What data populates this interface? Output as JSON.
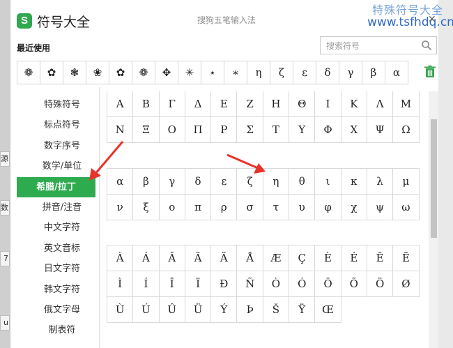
{
  "window": {
    "title": "符号大全",
    "ime_name": "搜狗五笔输入法",
    "logo_letter": "S"
  },
  "watermark": {
    "line1": "特殊符号大全",
    "line2": "www.tsfhdq.cn"
  },
  "recent": {
    "label": "最近使用",
    "symbols": [
      "❁",
      "✿",
      "❃",
      "❀",
      "✿",
      "❁",
      "✥",
      "✳",
      "⋆",
      "∗",
      "η",
      "ζ",
      "ε",
      "δ",
      "γ",
      "β",
      "α"
    ]
  },
  "search": {
    "placeholder": "搜索符号"
  },
  "sidebar": {
    "items": [
      "特殊符号",
      "标点符号",
      "数字序号",
      "数学/单位",
      "希腊/拉丁",
      "拼音/注音",
      "中文字符",
      "英文音标",
      "日文字符",
      "韩文字符",
      "俄文字母",
      "制表符"
    ],
    "active_index": 4
  },
  "grids": {
    "greek_upper": [
      "Α",
      "Β",
      "Γ",
      "Δ",
      "Ε",
      "Ζ",
      "Η",
      "Θ",
      "Ι",
      "Κ",
      "Λ",
      "Μ",
      "Ν",
      "Ξ",
      "Ο",
      "Π",
      "Ρ",
      "Σ",
      "Τ",
      "Υ",
      "Φ",
      "Χ",
      "Ψ",
      "Ω"
    ],
    "greek_lower": [
      "α",
      "β",
      "γ",
      "δ",
      "ε",
      "ζ",
      "η",
      "θ",
      "ι",
      "κ",
      "λ",
      "μ",
      "ν",
      "ξ",
      "ο",
      "π",
      "ρ",
      "σ",
      "τ",
      "υ",
      "φ",
      "χ",
      "ψ",
      "ω"
    ],
    "latin": [
      "À",
      "Á",
      "Â",
      "Ã",
      "Ä",
      "Å",
      "Æ",
      "Ç",
      "È",
      "É",
      "Ê",
      "Ë",
      "Ì",
      "Í",
      "Î",
      "Ï",
      "Ð",
      "Ñ",
      "Ò",
      "Ó",
      "Ô",
      "Õ",
      "Ö",
      "Ø",
      "Ù",
      "Ú",
      "Û",
      "Ü",
      "Ý",
      "Þ",
      "Š",
      "Ÿ",
      "Œ"
    ]
  },
  "background_tabs": [
    "源",
    "数",
    "7",
    "u"
  ],
  "colors": {
    "accent": "#2fab4f",
    "arrow": "#e8332a"
  },
  "icons": {
    "search": "search-icon",
    "trash": "trash-icon",
    "close": "close-icon"
  }
}
